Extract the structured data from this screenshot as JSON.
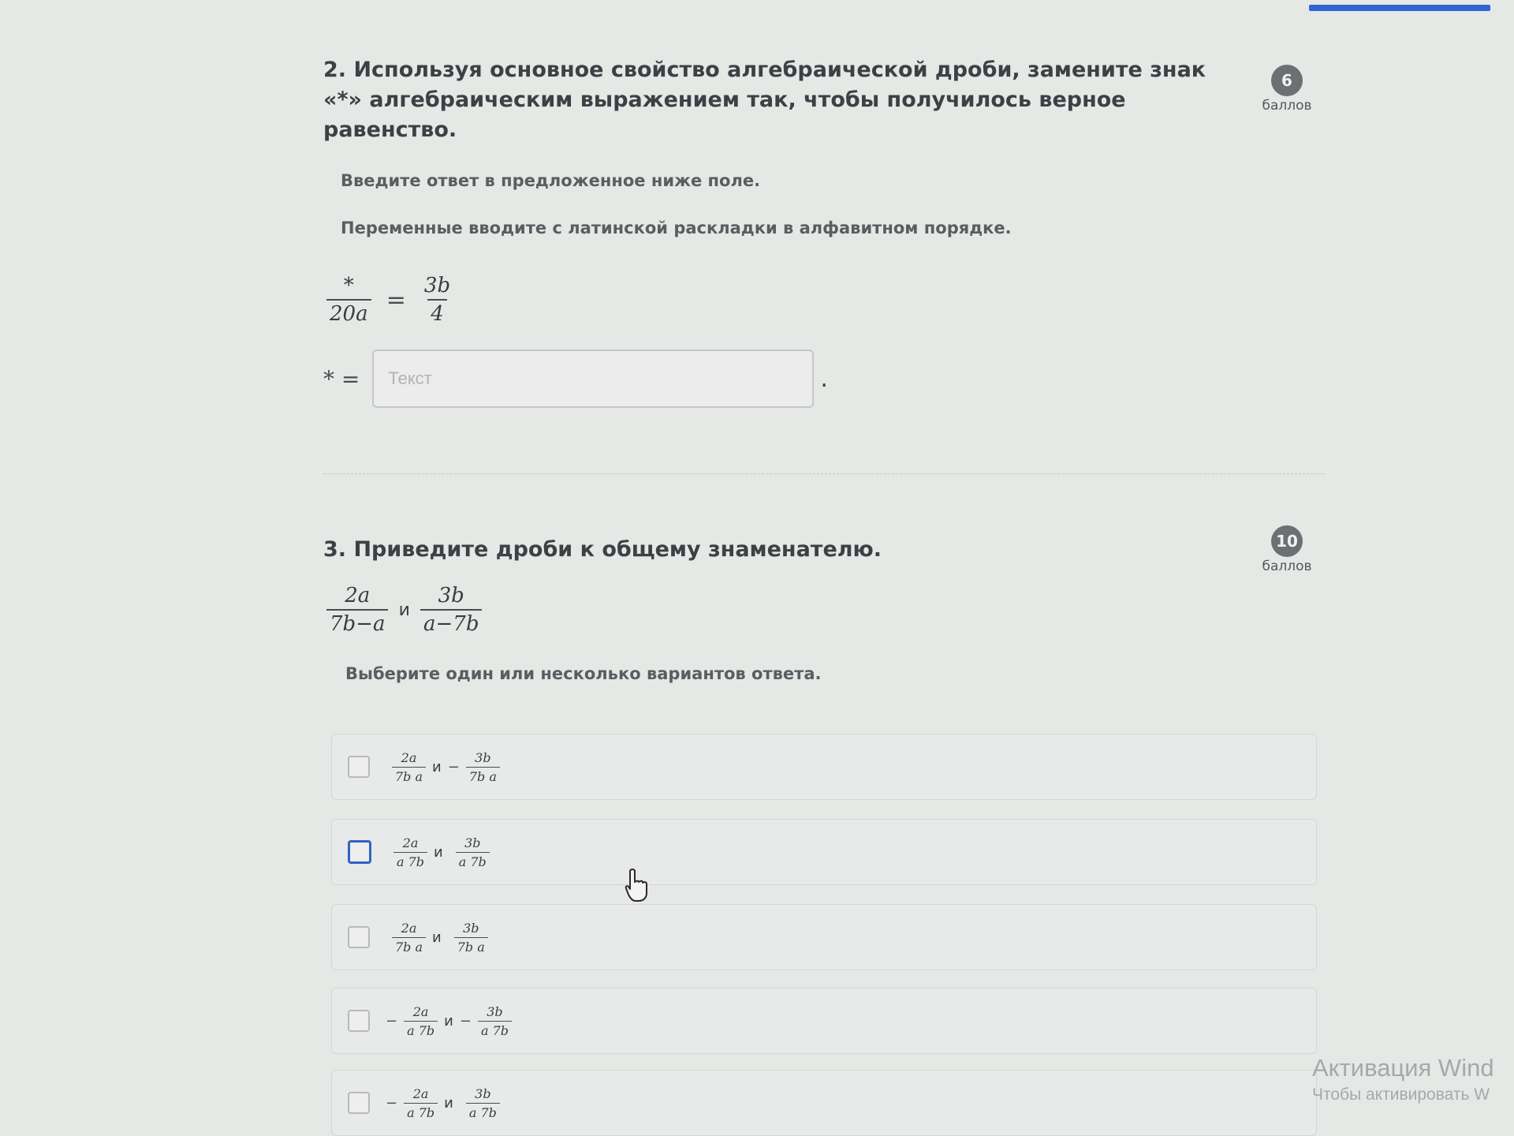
{
  "task2": {
    "title": "2. Используя основное свойство алгебраической дроби, замените знак «*» алгебраическим выражением так, чтобы получилось верное равенство.",
    "points": "6",
    "points_label": "баллов",
    "hint1": "Введите ответ в предложенное ниже поле.",
    "hint2": "Переменные вводите с латинской раскладки в алфавитном порядке.",
    "equation": {
      "left_num": "*",
      "left_den": "20a",
      "eq": "=",
      "right_num": "3b",
      "right_den": "4"
    },
    "answer": {
      "prefix": "* =",
      "value": "",
      "placeholder": "Текст",
      "suffix": "."
    }
  },
  "task3": {
    "title": "3. Приведите дроби к общему знаменателю.",
    "points": "10",
    "points_label": "баллов",
    "fractions": {
      "f1_num": "2a",
      "f1_den": "7b−a",
      "and": "и",
      "f2_num": "3b",
      "f2_den": "a−7b"
    },
    "hint": "Выберите один или несколько вариантов ответа.",
    "options": [
      {
        "sign1": "",
        "n1": "2a",
        "d1": "7b  a",
        "and": "и",
        "sign2": "−",
        "n2": "3b",
        "d2": "7b  a"
      },
      {
        "sign1": "",
        "n1": "2a",
        "d1": "a  7b",
        "and": "и",
        "sign2": "",
        "n2": "3b",
        "d2": "a  7b"
      },
      {
        "sign1": "",
        "n1": "2a",
        "d1": "7b  a",
        "and": "и",
        "sign2": "",
        "n2": "3b",
        "d2": "7b  a"
      },
      {
        "sign1": "−",
        "n1": "2a",
        "d1": "a  7b",
        "and": "и",
        "sign2": "−",
        "n2": "3b",
        "d2": "a  7b"
      },
      {
        "sign1": "−",
        "n1": "2a",
        "d1": "a  7b",
        "and": "и",
        "sign2": "",
        "n2": "3b",
        "d2": "a  7b"
      }
    ]
  },
  "watermark": {
    "title": "Активация Wind",
    "subtitle": "Чтобы активировать W"
  },
  "colors": {
    "accent": "#2e64d4",
    "badge": "#6d7073",
    "background": "#e6e8e6"
  },
  "icons": {
    "cursor": "hand-pointer-icon"
  }
}
